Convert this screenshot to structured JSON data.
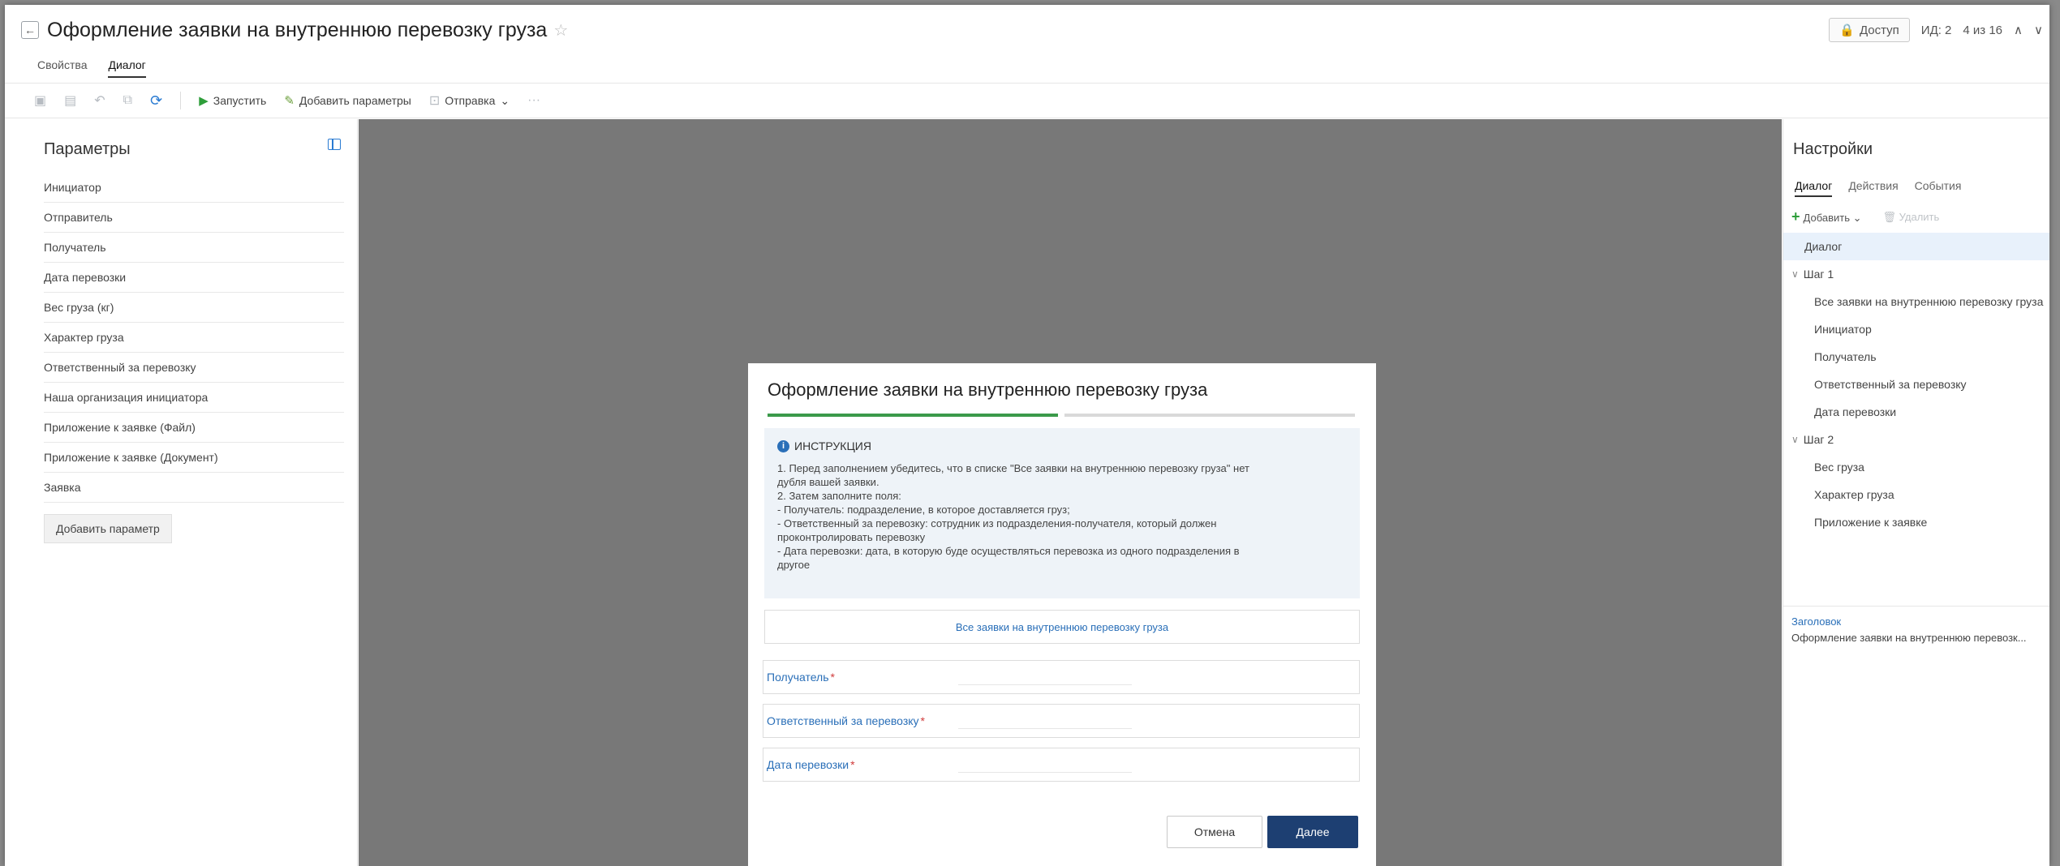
{
  "header": {
    "back_icon": "arrow-left-icon",
    "title": "Оформление заявки на внутреннюю перевозку груза",
    "star_icon": "star-icon",
    "access_label": "Доступ",
    "id_label": "ИД: 2",
    "pager": "4 из 16"
  },
  "tabs": [
    {
      "label": "Свойства"
    },
    {
      "label": "Диалог"
    }
  ],
  "toolbar": {
    "run_label": "Запустить",
    "add_params_label": "Добавить параметры",
    "send_label": "Отправка",
    "more_label": "···"
  },
  "left": {
    "title": "Параметры",
    "items": [
      "Инициатор",
      "Отправитель",
      "Получатель",
      "Дата перевозки",
      "Вес груза (кг)",
      "Характер груза",
      "Ответственный за перевозку",
      "Наша организация инициатора",
      "Приложение к заявке (Файл)",
      "Приложение к заявке (Документ)",
      "Заявка"
    ],
    "add_button": "Добавить параметр"
  },
  "dialog": {
    "title": "Оформление заявки на внутреннюю перевозку груза",
    "progress_steps": 2,
    "progress_current": 1,
    "info_title": "ИНСТРУКЦИЯ",
    "info_lines": [
      "1. Перед заполнением убедитесь, что в списке \"Все заявки на внутреннюю перевозку груза\" нет",
      "дубля вашей заявки.",
      "2. Затем заполните поля:",
      "- Получатель: подразделение, в которое доставляется груз;",
      "- Ответственный за перевозку: сотрудник из подразделения-получателя, который должен",
      "проконтролировать перевозку",
      "- Дата перевозки: дата, в которую буде осуществляться перевозка из одного подразделения в",
      "другое"
    ],
    "link_label": "Все заявки на внутреннюю перевозку груза",
    "fields": [
      {
        "label": "Получатель",
        "required": "*"
      },
      {
        "label": "Ответственный за перевозку",
        "required": "*"
      },
      {
        "label": "Дата перевозки",
        "required": "*"
      }
    ],
    "cancel_label": "Отмена",
    "next_label": "Далее"
  },
  "right": {
    "title": "Настройки",
    "tabs": [
      "Диалог",
      "Действия",
      "События"
    ],
    "add_label": "Добавить",
    "delete_label": "Удалить",
    "tree": {
      "root": "Диалог",
      "step1": "Шаг 1",
      "step1_items": [
        "Все заявки на внутреннюю перевозку груза",
        "Инициатор",
        "Получатель",
        "Ответственный за перевозку",
        "Дата перевозки"
      ],
      "step2": "Шаг 2",
      "step2_items": [
        "Вес груза",
        "Характер груза",
        "Приложение к заявке"
      ]
    },
    "prop_label": "Заголовок",
    "prop_value": "Оформление заявки на внутреннюю перевозк..."
  },
  "colors": {
    "accent": "#2a6fb8",
    "primary_button": "#1d3f72",
    "progress_done": "#3b9a4a",
    "canvas": "#787878"
  }
}
